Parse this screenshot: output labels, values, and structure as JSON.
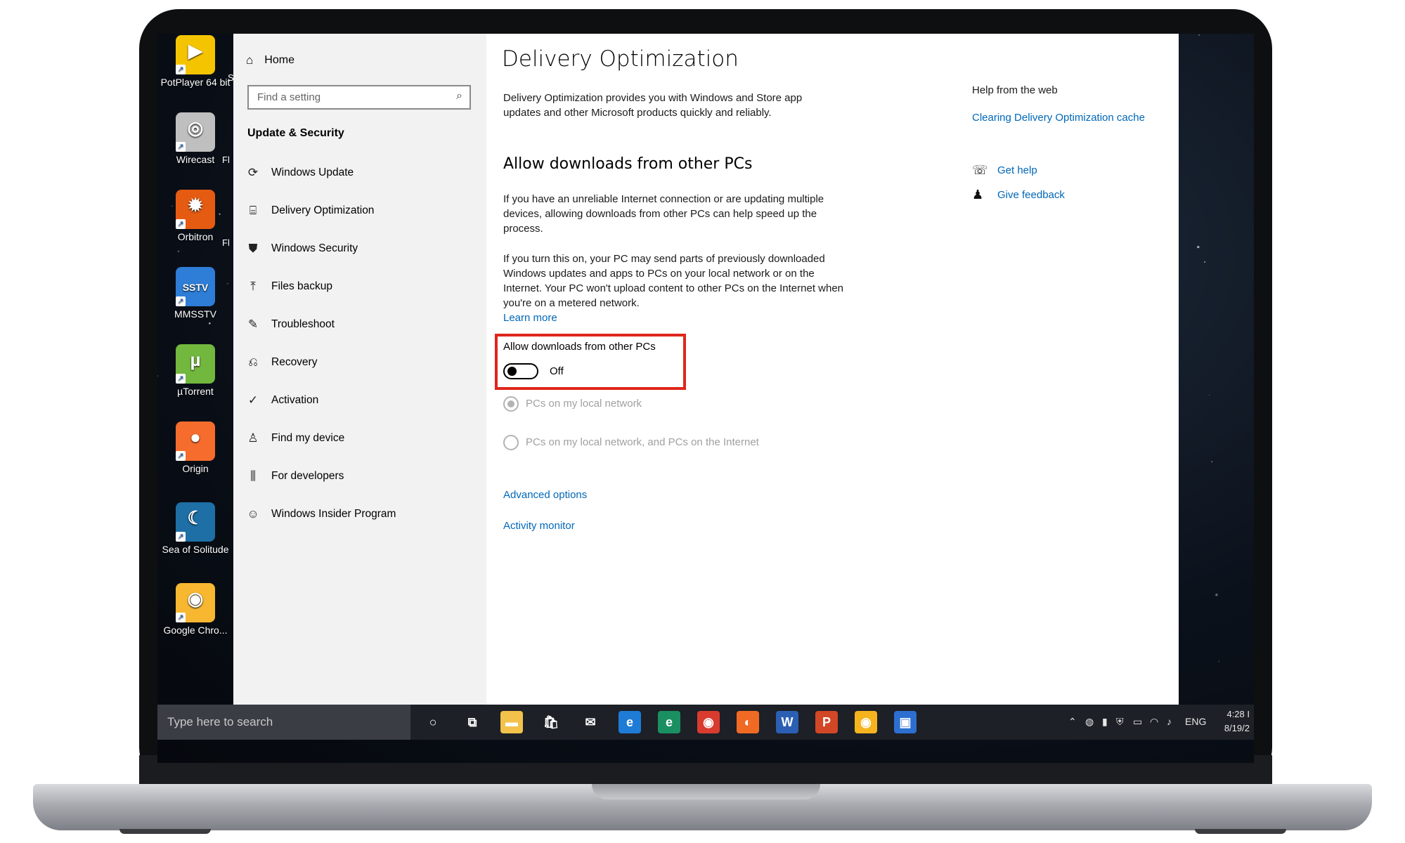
{
  "desktop": {
    "icons": [
      {
        "label": "PotPlayer 64 bit",
        "color": "#f5c400",
        "glyph": "▶",
        "sub": "Player"
      },
      {
        "label": "Wirecast",
        "color": "#bfbfbf",
        "glyph": "◎"
      },
      {
        "label": "Orbitron",
        "color": "#e55b12",
        "glyph": "✹"
      },
      {
        "label": "MMSSTV",
        "color": "#2e7dd6",
        "glyph": "SSTV"
      },
      {
        "label": "µTorrent",
        "color": "#72b73e",
        "glyph": "µ"
      },
      {
        "label": "Origin",
        "color": "#f56c2d",
        "glyph": "●"
      },
      {
        "label": "Sea of Solitude",
        "color": "#1d6fa5",
        "glyph": "☾"
      },
      {
        "label": "Google Chro...",
        "color": "#f7b731",
        "glyph": "◉"
      }
    ],
    "partial_labels": [
      "S",
      "Fl",
      "Fl"
    ]
  },
  "settings": {
    "nav": {
      "home_label": "Home",
      "search_placeholder": "Find a setting",
      "section_title": "Update & Security",
      "items": [
        {
          "label": "Windows Update",
          "icon": "refresh-icon",
          "glyph": "⟳"
        },
        {
          "label": "Delivery Optimization",
          "icon": "delivery-icon",
          "glyph": "⌸"
        },
        {
          "label": "Windows Security",
          "icon": "shield-icon",
          "glyph": "⛊"
        },
        {
          "label": "Files backup",
          "icon": "upload-icon",
          "glyph": "⤒"
        },
        {
          "label": "Troubleshoot",
          "icon": "wrench-icon",
          "glyph": "✎"
        },
        {
          "label": "Recovery",
          "icon": "recovery-icon",
          "glyph": "⎌"
        },
        {
          "label": "Activation",
          "icon": "check-circle-icon",
          "glyph": "✓"
        },
        {
          "label": "Find my device",
          "icon": "person-icon",
          "glyph": "♙"
        },
        {
          "label": "For developers",
          "icon": "developer-icon",
          "glyph": "⫼"
        },
        {
          "label": "Windows Insider Program",
          "icon": "insider-icon",
          "glyph": "☺"
        }
      ]
    },
    "main": {
      "title": "Delivery Optimization",
      "intro": "Delivery Optimization provides you with Windows and Store app updates and other Microsoft products quickly and reliably.",
      "section_heading": "Allow downloads from other PCs",
      "para1": "If you have an unreliable Internet connection or are updating multiple devices, allowing downloads from other PCs can help speed up the process.",
      "para2": "If you turn this on, your PC may send parts of previously downloaded Windows updates and apps to PCs on your local network or on the Internet. Your PC won't upload content to other PCs on the Internet when you're on a metered network.",
      "learn_more": "Learn more",
      "toggle_label": "Allow downloads from other PCs",
      "toggle_state": "Off",
      "toggle_on": false,
      "radio1": "PCs on my local network",
      "radio2": "PCs on my local network, and PCs on the Internet",
      "advanced": "Advanced options",
      "activity": "Activity monitor"
    },
    "help": {
      "heading": "Help from the web",
      "web_link": "Clearing Delivery Optimization cache",
      "get_help": "Get help",
      "feedback": "Give feedback"
    }
  },
  "taskbar": {
    "search_placeholder": "Type here to search",
    "apps": [
      {
        "name": "cortana-icon",
        "glyph": "○",
        "color": "transparent"
      },
      {
        "name": "task-view-icon",
        "glyph": "⧉",
        "color": "transparent"
      },
      {
        "name": "file-explorer-icon",
        "glyph": "▬",
        "color": "#f2c24a"
      },
      {
        "name": "store-icon",
        "glyph": "🛍",
        "color": "transparent"
      },
      {
        "name": "mail-icon",
        "glyph": "✉",
        "color": "transparent"
      },
      {
        "name": "edge-icon",
        "glyph": "e",
        "color": "#1e7bd6"
      },
      {
        "name": "edge-beta-icon",
        "glyph": "e",
        "color": "#1a8f62"
      },
      {
        "name": "chrome-icon",
        "glyph": "◉",
        "color": "#d93c2f"
      },
      {
        "name": "firefox-icon",
        "glyph": "◐",
        "color": "#f06a24"
      },
      {
        "name": "word-icon",
        "glyph": "W",
        "color": "#2b5fb3"
      },
      {
        "name": "powerpoint-icon",
        "glyph": "P",
        "color": "#d24726"
      },
      {
        "name": "chrome-canary-icon",
        "glyph": "◉",
        "color": "#f5b31e"
      },
      {
        "name": "remote-desktop-icon",
        "glyph": "▣",
        "color": "#2d6fd1"
      }
    ],
    "tray_lang": "ENG",
    "time": "4:28 I",
    "date": "8/19/2"
  }
}
